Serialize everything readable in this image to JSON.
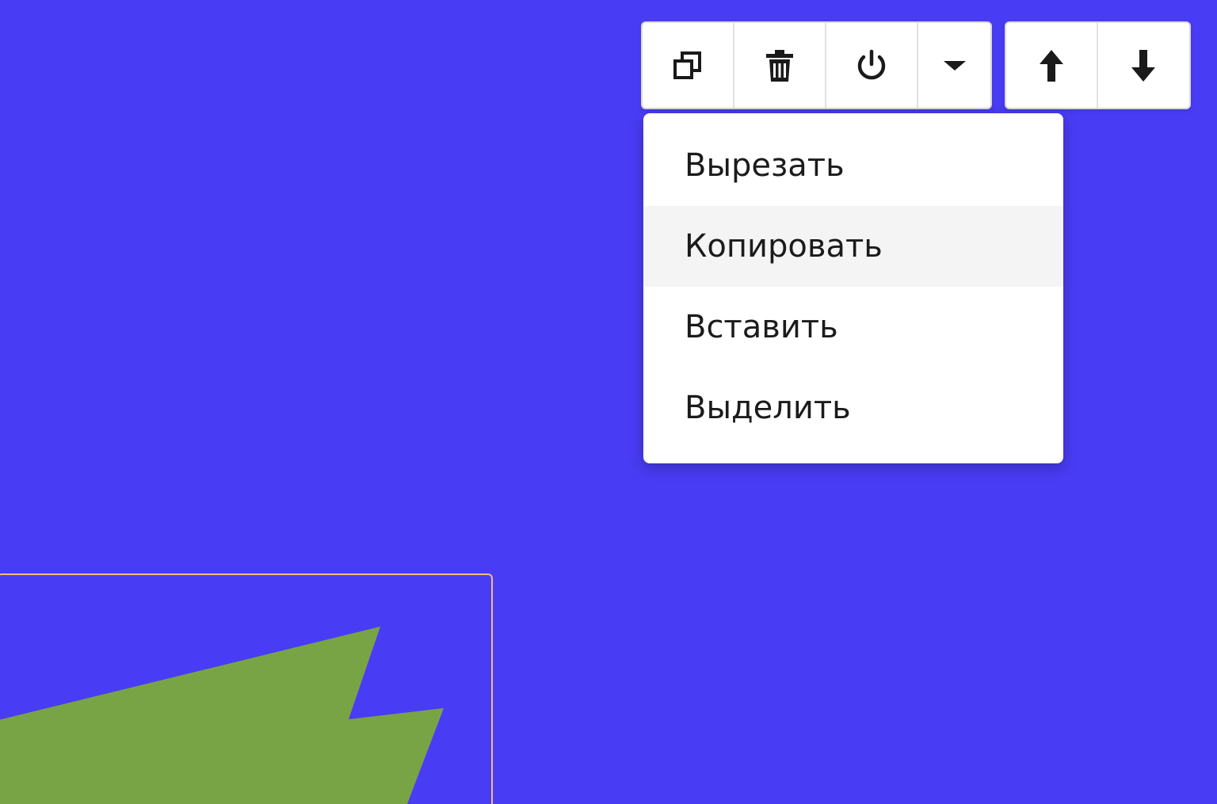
{
  "canvas": {
    "background_color": "#493cf5",
    "shape_fill_color": "#79a445",
    "selection_border_color": "#f0c070"
  },
  "toolbar": {
    "buttons": [
      {
        "icon": "copy-icon"
      },
      {
        "icon": "trash-icon"
      },
      {
        "icon": "power-icon"
      },
      {
        "icon": "caret-down-icon"
      }
    ]
  },
  "order_toolbar": {
    "buttons": [
      {
        "icon": "arrow-up-icon"
      },
      {
        "icon": "arrow-down-icon"
      }
    ]
  },
  "context_menu": {
    "items": [
      {
        "label": "Вырезать"
      },
      {
        "label": "Копировать",
        "highlighted": true
      },
      {
        "label": "Вставить"
      },
      {
        "label": "Выделить"
      }
    ]
  }
}
